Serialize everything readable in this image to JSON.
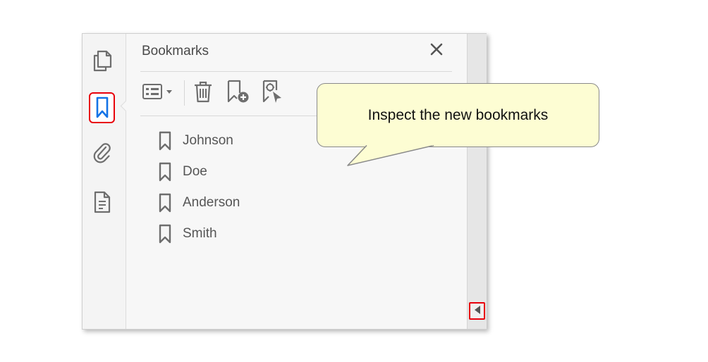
{
  "panel": {
    "title": "Bookmarks",
    "close_icon": "close-icon"
  },
  "rail": {
    "items": [
      {
        "name": "pages",
        "icon": "pages-icon"
      },
      {
        "name": "bookmarks",
        "icon": "bookmark-icon",
        "active": true
      },
      {
        "name": "attachments",
        "icon": "paperclip-icon"
      },
      {
        "name": "document",
        "icon": "document-icon"
      }
    ]
  },
  "toolbar": {
    "options_icon": "options-menu-icon",
    "delete_icon": "trash-icon",
    "new_bookmark_icon": "add-bookmark-icon",
    "find_bookmark_icon": "find-bookmark-icon"
  },
  "bookmarks": [
    {
      "label": "Johnson"
    },
    {
      "label": "Doe"
    },
    {
      "label": "Anderson"
    },
    {
      "label": "Smith"
    }
  ],
  "callout": {
    "text": "Inspect the new bookmarks"
  },
  "colors": {
    "highlight": "#e8000b",
    "active_icon": "#1473e6",
    "callout_fill": "#fdfdd3",
    "icon_gray": "#6e6e6e"
  }
}
